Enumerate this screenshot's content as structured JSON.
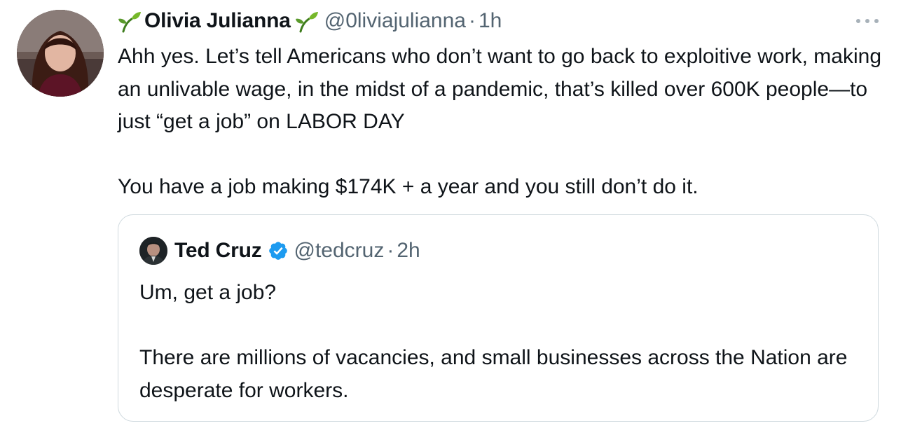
{
  "tweet": {
    "author": {
      "display_name": "Olivia Julianna",
      "handle": "@0liviajulianna",
      "separator": "·",
      "time": "1h",
      "name_emoji": "seedling-icon"
    },
    "text_paragraph_1": "Ahh yes. Let’s tell Americans who don’t want to go back to exploitive work, making an unlivable wage,  in the midst of a pandemic, that’s killed over 600K people—to just “get a job” on LABOR DAY",
    "text_paragraph_2": "You have a job making $174K + a year and you still don’t do it.",
    "more_icon": "more-horizontal-icon"
  },
  "quoted_tweet": {
    "author": {
      "display_name": "Ted Cruz",
      "verified": true,
      "handle": "@tedcruz",
      "separator": "·",
      "time": "2h"
    },
    "text_paragraph_1": "Um, get a job?",
    "text_paragraph_2": "There are millions of vacancies, and small businesses across the Nation are desperate for workers."
  },
  "colors": {
    "text_primary": "#0f1419",
    "text_secondary": "#536471",
    "border": "#cfd9de",
    "verified_blue": "#1d9bf0",
    "seedling_green": "#5a9a2c"
  }
}
